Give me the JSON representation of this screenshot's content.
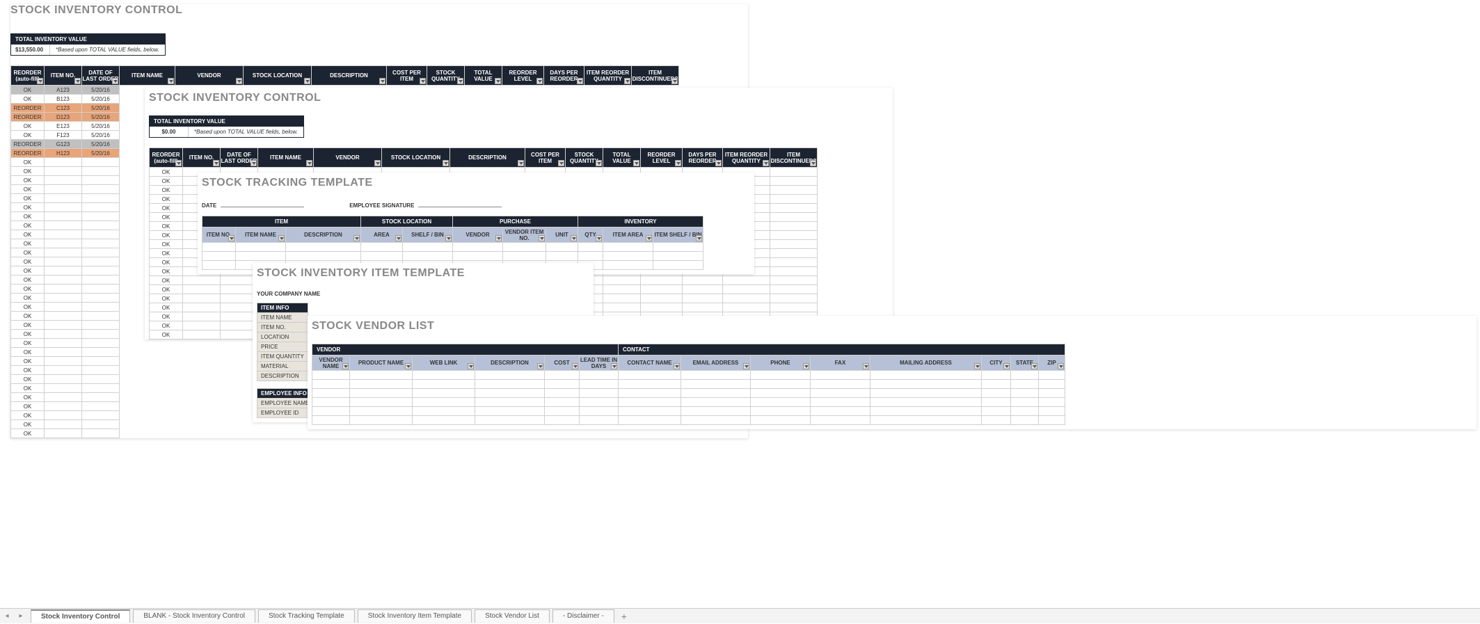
{
  "sheet1": {
    "title": "STOCK INVENTORY CONTROL",
    "tiv_label": "TOTAL INVENTORY VALUE",
    "tiv_value": "$13,550.00",
    "tiv_note": "*Based upon TOTAL VALUE fields, below.",
    "columns": [
      "REORDER (auto-fill)",
      "ITEM NO.",
      "DATE OF LAST ORDER",
      "ITEM NAME",
      "VENDOR",
      "STOCK LOCATION",
      "DESCRIPTION",
      "COST PER ITEM",
      "STOCK QUANTITY",
      "TOTAL VALUE",
      "REORDER LEVEL",
      "DAYS PER REORDER",
      "ITEM REORDER QUANTITY",
      "ITEM DISCONTINUED?"
    ],
    "rows": [
      {
        "status": "OK",
        "cls": "st-grey",
        "item": "A123",
        "date": "5/20/16"
      },
      {
        "status": "OK",
        "cls": "st-ok",
        "item": "B123",
        "date": "5/20/16"
      },
      {
        "status": "REORDER",
        "cls": "st-reorder",
        "item": "C123",
        "date": "5/20/16"
      },
      {
        "status": "REORDER",
        "cls": "st-reorder",
        "item": "D123",
        "date": "5/20/16"
      },
      {
        "status": "OK",
        "cls": "st-ok",
        "item": "E123",
        "date": "5/20/16"
      },
      {
        "status": "OK",
        "cls": "st-ok",
        "item": "F123",
        "date": "5/20/16"
      },
      {
        "status": "REORDER",
        "cls": "st-grey",
        "item": "G123",
        "date": "5/20/16"
      },
      {
        "status": "REORDER",
        "cls": "st-reorder",
        "item": "H123",
        "date": "5/20/16"
      }
    ],
    "ok_label": "OK",
    "empty_ok_count": 31
  },
  "sheet2": {
    "title": "STOCK INVENTORY CONTROL",
    "tiv_label": "TOTAL INVENTORY VALUE",
    "tiv_value": "$0.00",
    "tiv_note": "*Based upon TOTAL VALUE fields, below.",
    "columns": [
      "REORDER (auto-fill)",
      "ITEM NO.",
      "DATE OF LAST ORDER",
      "ITEM NAME",
      "VENDOR",
      "STOCK LOCATION",
      "DESCRIPTION",
      "COST PER ITEM",
      "STOCK QUANTITY",
      "TOTAL VALUE",
      "REORDER LEVEL",
      "DAYS PER REORDER",
      "ITEM REORDER QUANTITY",
      "ITEM DISCONTINUED?"
    ],
    "ok_label": "OK",
    "ok_count": 19
  },
  "sheet3": {
    "title": "STOCK TRACKING TEMPLATE",
    "date_label": "DATE",
    "sig_label": "EMPLOYEE SIGNATURE",
    "groups": [
      "ITEM",
      "STOCK LOCATION",
      "PURCHASE",
      "INVENTORY"
    ],
    "columns": [
      "ITEM NO.",
      "ITEM NAME",
      "DESCRIPTION",
      "AREA",
      "SHELF / BIN",
      "VENDOR",
      "VENDOR ITEM NO.",
      "UNIT",
      "QTY",
      "ITEM AREA",
      "ITEM SHELF / BIN"
    ]
  },
  "sheet4": {
    "title": "STOCK INVENTORY ITEM TEMPLATE",
    "company": "YOUR COMPANY NAME",
    "item_info_hdr": "ITEM INFO",
    "item_info": [
      "ITEM NAME",
      "ITEM NO.",
      "LOCATION",
      "PRICE",
      "ITEM QUANTITY",
      "MATERIAL",
      "DESCRIPTION"
    ],
    "emp_info_hdr": "EMPLOYEE INFO",
    "emp_info": [
      "EMPLOYEE NAME",
      "EMPLOYEE ID"
    ]
  },
  "sheet5": {
    "title": "STOCK VENDOR LIST",
    "groups": [
      "VENDOR",
      "CONTACT"
    ],
    "columns": [
      "VENDOR NAME",
      "PRODUCT NAME",
      "WEB LINK",
      "DESCRIPTION",
      "COST",
      "LEAD TIME IN DAYS",
      "CONTACT NAME",
      "EMAIL ADDRESS",
      "PHONE",
      "FAX",
      "MAILING ADDRESS",
      "CITY",
      "STATE",
      "ZIP"
    ]
  },
  "tabs": [
    "Stock Inventory Control",
    "BLANK - Stock Inventory Control",
    "Stock Tracking Template",
    "Stock Inventory Item Template",
    "Stock Vendor List",
    "- Disclaimer -"
  ],
  "tab_plus": "+"
}
